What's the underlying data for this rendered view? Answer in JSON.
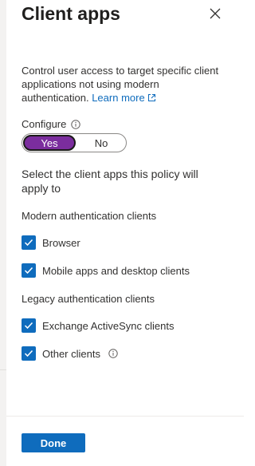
{
  "panel": {
    "title": "Client apps",
    "description": "Control user access to target specific client applications not using modern authentication.",
    "learn_more": "Learn more"
  },
  "configure": {
    "label": "Configure",
    "options": [
      "Yes",
      "No"
    ],
    "selected": "Yes"
  },
  "lead_text": "Select the client apps this policy will apply to",
  "modern": {
    "heading": "Modern authentication clients",
    "items": [
      {
        "label": "Browser",
        "checked": true
      },
      {
        "label": "Mobile apps and desktop clients",
        "checked": true
      }
    ]
  },
  "legacy": {
    "heading": "Legacy authentication clients",
    "items": [
      {
        "label": "Exchange ActiveSync clients",
        "checked": true
      },
      {
        "label": "Other clients",
        "checked": true
      }
    ]
  },
  "footer": {
    "done_label": "Done"
  },
  "colors": {
    "accent": "#0f6cbd",
    "toggle_selected": "#7b2d9e"
  }
}
